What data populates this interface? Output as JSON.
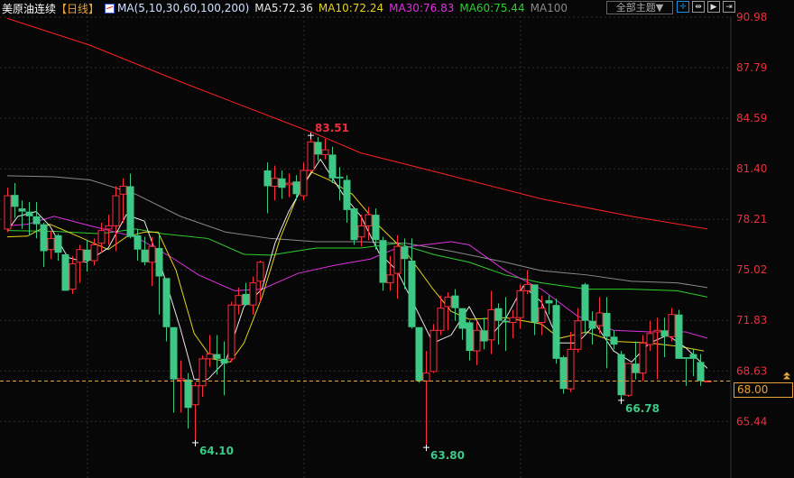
{
  "header": {
    "title": "美原油连续",
    "period": "【日线】",
    "ma_definition": "MA(5,10,30,60,100,200)",
    "ma_values": [
      {
        "label": "MA5:72.36",
        "color": "#e8e8e8"
      },
      {
        "label": "MA10:72.24",
        "color": "#e6d21c"
      },
      {
        "label": "MA30:76.83",
        "color": "#e030e0"
      },
      {
        "label": "MA60:75.44",
        "color": "#2ed02e"
      },
      {
        "label": "MA100",
        "color": "#8a8a8a"
      }
    ],
    "theme_button": "全部主题▼",
    "tools": [
      {
        "icon": "crosshair-icon",
        "glyph": "✛"
      },
      {
        "icon": "zoom-range-icon",
        "glyph": "⇹"
      },
      {
        "icon": "play-forward-icon",
        "glyph": "▶"
      },
      {
        "icon": "move-right-icon",
        "glyph": "⇥"
      }
    ]
  },
  "chart_data": {
    "type": "candlestick",
    "ylim": [
      63.3,
      91.2
    ],
    "y_ticks": [
      "90.98",
      "87.79",
      "84.59",
      "81.40",
      "78.21",
      "75.02",
      "71.83",
      "68.63",
      "65.44"
    ],
    "y_tick_values": [
      90.98,
      87.79,
      84.59,
      81.4,
      78.21,
      75.02,
      71.83,
      68.63,
      65.44
    ],
    "up_color": "#ff2d3c",
    "down_color": "#3cc985",
    "current_price": {
      "label": "68.00",
      "value": 68.0,
      "color": "#e8a33a"
    },
    "annotations": [
      {
        "label": "83.51",
        "value": 83.51,
        "index": 42,
        "color": "#e8313d"
      },
      {
        "label": "64.10",
        "value": 64.1,
        "index": 26,
        "color": "#3cc985"
      },
      {
        "label": "63.80",
        "value": 63.8,
        "index": 58,
        "color": "#3cc985"
      },
      {
        "label": "66.78",
        "value": 66.78,
        "index": 85,
        "color": "#3cc985"
      }
    ],
    "ohlc": [
      [
        77.6,
        80.2,
        77.4,
        79.7
      ],
      [
        79.75,
        80.5,
        78.3,
        79.0
      ],
      [
        78.9,
        79.4,
        77.6,
        78.7
      ],
      [
        78.7,
        79.3,
        77.2,
        78.4
      ],
      [
        78.4,
        79.3,
        77.0,
        77.9
      ],
      [
        77.9,
        78.0,
        75.2,
        76.2
      ],
      [
        76.3,
        77.5,
        75.7,
        77.0
      ],
      [
        77.2,
        77.3,
        75.6,
        76.1
      ],
      [
        76.0,
        76.0,
        73.7,
        73.7
      ],
      [
        73.8,
        75.9,
        73.5,
        75.4
      ],
      [
        75.5,
        76.6,
        74.2,
        76.3
      ],
      [
        76.3,
        76.9,
        74.9,
        75.6
      ],
      [
        75.6,
        77.0,
        75.3,
        76.6
      ],
      [
        76.7,
        78.0,
        76.1,
        77.5
      ],
      [
        77.6,
        78.5,
        76.6,
        77.8
      ],
      [
        77.8,
        80.3,
        76.2,
        79.7
      ],
      [
        79.8,
        80.8,
        78.0,
        80.3
      ],
      [
        80.3,
        81.1,
        77.0,
        77.1
      ],
      [
        77.2,
        77.6,
        75.6,
        76.3
      ],
      [
        76.3,
        77.1,
        75.3,
        75.5
      ],
      [
        75.5,
        77.1,
        74.0,
        76.5
      ],
      [
        76.4,
        77.2,
        72.2,
        74.6
      ],
      [
        74.5,
        74.5,
        70.5,
        71.4
      ],
      [
        71.4,
        71.4,
        66.0,
        68.1
      ],
      [
        68.05,
        69.3,
        66.0,
        68.15
      ],
      [
        68.1,
        68.5,
        65.0,
        66.3
      ],
      [
        66.5,
        67.9,
        64.1,
        67.7
      ],
      [
        67.7,
        69.6,
        67.0,
        69.4
      ],
      [
        69.4,
        70.9,
        68.9,
        69.7
      ],
      [
        69.7,
        70.9,
        68.4,
        69.4
      ],
      [
        69.4,
        70.5,
        67.1,
        69.1
      ],
      [
        69.4,
        73.0,
        69.2,
        72.8
      ],
      [
        72.8,
        73.9,
        72.2,
        73.4
      ],
      [
        73.5,
        74.2,
        72.8,
        72.8
      ],
      [
        72.8,
        74.6,
        72.2,
        74.2
      ],
      [
        74.3,
        75.6,
        73.0,
        75.5
      ],
      [
        81.3,
        81.8,
        78.6,
        80.3
      ],
      [
        80.3,
        81.6,
        79.4,
        80.8
      ],
      [
        80.8,
        81.3,
        79.5,
        80.2
      ],
      [
        80.4,
        81.1,
        79.6,
        80.5
      ],
      [
        80.6,
        81.0,
        79.4,
        79.8
      ],
      [
        79.7,
        81.8,
        79.4,
        81.3
      ],
      [
        81.3,
        83.51,
        81.2,
        83.1
      ],
      [
        83.1,
        83.4,
        81.9,
        82.3
      ],
      [
        82.3,
        83.3,
        82.0,
        82.6
      ],
      [
        82.3,
        82.8,
        80.5,
        80.8
      ],
      [
        80.9,
        81.5,
        79.4,
        80.8
      ],
      [
        80.7,
        81.0,
        78.0,
        78.8
      ],
      [
        78.9,
        78.9,
        76.6,
        76.9
      ],
      [
        77.1,
        78.5,
        76.5,
        77.8
      ],
      [
        77.8,
        79.0,
        76.9,
        78.5
      ],
      [
        78.5,
        78.9,
        76.3,
        76.9
      ],
      [
        76.9,
        77.1,
        73.7,
        74.2
      ],
      [
        74.2,
        75.9,
        73.7,
        74.7
      ],
      [
        74.8,
        77.2,
        73.2,
        76.5
      ],
      [
        76.5,
        77.0,
        73.8,
        75.7
      ],
      [
        75.6,
        77.0,
        71.3,
        71.4
      ],
      [
        71.4,
        71.4,
        67.9,
        68.0
      ],
      [
        68.0,
        69.9,
        63.8,
        68.5
      ],
      [
        68.6,
        71.6,
        68.5,
        71.2
      ],
      [
        71.2,
        73.4,
        70.9,
        72.6
      ],
      [
        72.7,
        73.6,
        71.2,
        73.3
      ],
      [
        73.4,
        73.8,
        71.8,
        72.6
      ],
      [
        72.6,
        72.6,
        70.6,
        71.3
      ],
      [
        71.7,
        71.8,
        69.3,
        69.9
      ],
      [
        69.9,
        71.8,
        69.0,
        71.2
      ],
      [
        71.2,
        72.0,
        70.0,
        70.5
      ],
      [
        70.6,
        73.7,
        69.7,
        72.5
      ],
      [
        72.6,
        72.9,
        70.3,
        71.8
      ],
      [
        71.8,
        73.3,
        69.9,
        71.7
      ],
      [
        71.7,
        72.5,
        70.7,
        72.0
      ],
      [
        72.0,
        74.1,
        71.3,
        73.7
      ],
      [
        73.7,
        75.0,
        73.5,
        74.1
      ],
      [
        74.1,
        74.1,
        70.9,
        71.7
      ],
      [
        71.7,
        73.4,
        70.9,
        72.6
      ],
      [
        73.1,
        73.4,
        72.2,
        72.9
      ],
      [
        72.8,
        73.2,
        69.1,
        69.4
      ],
      [
        69.5,
        69.6,
        67.2,
        67.5
      ],
      [
        67.5,
        71.1,
        67.3,
        70.0
      ],
      [
        70.0,
        72.6,
        69.8,
        71.8
      ],
      [
        74.1,
        74.2,
        71.0,
        71.8
      ],
      [
        71.8,
        72.4,
        70.3,
        71.3
      ],
      [
        71.5,
        73.3,
        71.0,
        72.3
      ],
      [
        72.3,
        73.3,
        68.8,
        70.8
      ],
      [
        70.8,
        71.2,
        70.0,
        70.3
      ],
      [
        69.7,
        69.9,
        66.78,
        67.1
      ],
      [
        67.1,
        69.1,
        67.0,
        69.1
      ],
      [
        69.1,
        70.5,
        68.1,
        68.5
      ],
      [
        68.5,
        70.9,
        68.0,
        70.4
      ],
      [
        70.3,
        71.8,
        69.9,
        71.0
      ],
      [
        71.1,
        72.0,
        68.1,
        71.2
      ],
      [
        71.2,
        72.0,
        69.5,
        70.8
      ],
      [
        70.8,
        72.6,
        70.5,
        72.2
      ],
      [
        72.2,
        72.5,
        69.4,
        69.4
      ],
      [
        69.5,
        69.5,
        67.7,
        69.4
      ],
      [
        69.7,
        70.0,
        68.3,
        69.4
      ],
      [
        69.2,
        69.7,
        67.7,
        68.0
      ],
      [
        68.0,
        68.0,
        68.0,
        68.0
      ]
    ],
    "moving_averages": [
      {
        "name": "MA200",
        "color": "#ff2020",
        "points": [
          [
            0,
            90.9
          ],
          [
            11.5,
            89.2
          ],
          [
            24,
            86.9
          ],
          [
            36.5,
            84.7
          ],
          [
            42.8,
            83.6
          ],
          [
            49,
            82.4
          ],
          [
            61.5,
            80.96
          ],
          [
            74,
            79.5
          ],
          [
            86.5,
            78.4
          ],
          [
            97,
            77.6
          ]
        ]
      },
      {
        "name": "MA100",
        "color": "#8a8a8a",
        "points": [
          [
            0,
            80.96
          ],
          [
            6.5,
            80.9
          ],
          [
            11.5,
            80.7
          ],
          [
            17.8,
            79.8
          ],
          [
            24,
            78.4
          ],
          [
            30.3,
            77.4
          ],
          [
            36.5,
            77.0
          ],
          [
            42.8,
            76.8
          ],
          [
            49,
            76.8
          ],
          [
            55.3,
            76.7
          ],
          [
            61.5,
            76.2
          ],
          [
            69,
            75.5
          ],
          [
            74,
            74.97
          ],
          [
            80.3,
            74.7
          ],
          [
            86.5,
            74.3
          ],
          [
            92.8,
            74.2
          ],
          [
            97,
            73.9
          ]
        ]
      },
      {
        "name": "MA60",
        "color": "#2ed02e",
        "points": [
          [
            0,
            77.5
          ],
          [
            6.5,
            77.45
          ],
          [
            12.8,
            77.3
          ],
          [
            17.8,
            77.6
          ],
          [
            21.5,
            77.3
          ],
          [
            27.8,
            77.0
          ],
          [
            32.8,
            76.0
          ],
          [
            36.5,
            75.95
          ],
          [
            42.8,
            76.4
          ],
          [
            49,
            76.4
          ],
          [
            54,
            76.7
          ],
          [
            59,
            76.0
          ],
          [
            64,
            75.5
          ],
          [
            69,
            74.7
          ],
          [
            74,
            74.2
          ],
          [
            80.3,
            73.8
          ],
          [
            86.5,
            73.8
          ],
          [
            92.8,
            73.7
          ],
          [
            97,
            73.3
          ]
        ]
      },
      {
        "name": "MA30",
        "color": "#e030e0",
        "points": [
          [
            0,
            77.8
          ],
          [
            2.8,
            77.9
          ],
          [
            6.5,
            78.4
          ],
          [
            11.5,
            77.8
          ],
          [
            17.8,
            77.1
          ],
          [
            22.8,
            75.8
          ],
          [
            26.5,
            74.7
          ],
          [
            31.5,
            73.7
          ],
          [
            35.3,
            73.8
          ],
          [
            40.3,
            74.8
          ],
          [
            45.3,
            75.3
          ],
          [
            50.3,
            75.7
          ],
          [
            54,
            76.4
          ],
          [
            57.8,
            76.6
          ],
          [
            61.5,
            76.8
          ],
          [
            64,
            76.6
          ],
          [
            69,
            74.97
          ],
          [
            74,
            73.8
          ],
          [
            79,
            72.1
          ],
          [
            84,
            71.2
          ],
          [
            89,
            71.1
          ],
          [
            94,
            71.1
          ],
          [
            97,
            70.7
          ]
        ]
      },
      {
        "name": "MA10",
        "color": "#e6d21c",
        "points": [
          [
            0,
            77.1
          ],
          [
            2.8,
            77.15
          ],
          [
            5.9,
            77.9
          ],
          [
            9,
            77.3
          ],
          [
            11.5,
            76.8
          ],
          [
            14,
            76.3
          ],
          [
            16.5,
            77.1
          ],
          [
            19,
            77.4
          ],
          [
            20.9,
            77.4
          ],
          [
            23.4,
            74.97
          ],
          [
            25.9,
            71.0
          ],
          [
            28.4,
            69.4
          ],
          [
            30.9,
            69.2
          ],
          [
            32.8,
            70.4
          ],
          [
            35.3,
            73.3
          ],
          [
            37.8,
            77.0
          ],
          [
            40.3,
            79.8
          ],
          [
            42.1,
            81.2
          ],
          [
            44.6,
            80.7
          ],
          [
            47.8,
            79.8
          ],
          [
            51.5,
            77.8
          ],
          [
            55.3,
            76.1
          ],
          [
            59,
            73.8
          ],
          [
            61.5,
            72.4
          ],
          [
            64,
            71.9
          ],
          [
            69,
            72.0
          ],
          [
            74,
            71.6
          ],
          [
            76.5,
            70.7
          ],
          [
            80.3,
            71.1
          ],
          [
            84,
            70.5
          ],
          [
            89,
            70.4
          ],
          [
            92.8,
            70.2
          ],
          [
            96.5,
            69.9
          ]
        ]
      },
      {
        "name": "MA5",
        "color": "#e8e8e8",
        "points": [
          [
            0,
            77.5
          ],
          [
            1.5,
            78.4
          ],
          [
            4,
            78.7
          ],
          [
            5.9,
            77.8
          ],
          [
            8.4,
            75.8
          ],
          [
            10.9,
            75.5
          ],
          [
            14,
            76.4
          ],
          [
            16.5,
            78.5
          ],
          [
            19,
            78.1
          ],
          [
            21.5,
            74.97
          ],
          [
            24,
            71.3
          ],
          [
            25.9,
            68.1
          ],
          [
            27.8,
            68.1
          ],
          [
            30.3,
            69.3
          ],
          [
            32.8,
            72.7
          ],
          [
            35.3,
            73.8
          ],
          [
            37.1,
            76.7
          ],
          [
            39,
            78.7
          ],
          [
            41.5,
            80.7
          ],
          [
            43.4,
            82.0
          ],
          [
            46.5,
            79.8
          ],
          [
            49,
            78.4
          ],
          [
            51.5,
            76.1
          ],
          [
            54,
            74.97
          ],
          [
            56.5,
            72.7
          ],
          [
            59,
            70.4
          ],
          [
            61.5,
            70.9
          ],
          [
            64,
            72.7
          ],
          [
            66.5,
            70.6
          ],
          [
            69,
            71.9
          ],
          [
            71.5,
            74.0
          ],
          [
            74,
            73.0
          ],
          [
            76.5,
            70.4
          ],
          [
            79,
            70.4
          ],
          [
            81.5,
            71.6
          ],
          [
            84,
            69.9
          ],
          [
            86.5,
            69.2
          ],
          [
            89,
            70.4
          ],
          [
            91.5,
            70.9
          ],
          [
            94,
            70.1
          ],
          [
            97,
            68.8
          ]
        ]
      }
    ]
  }
}
